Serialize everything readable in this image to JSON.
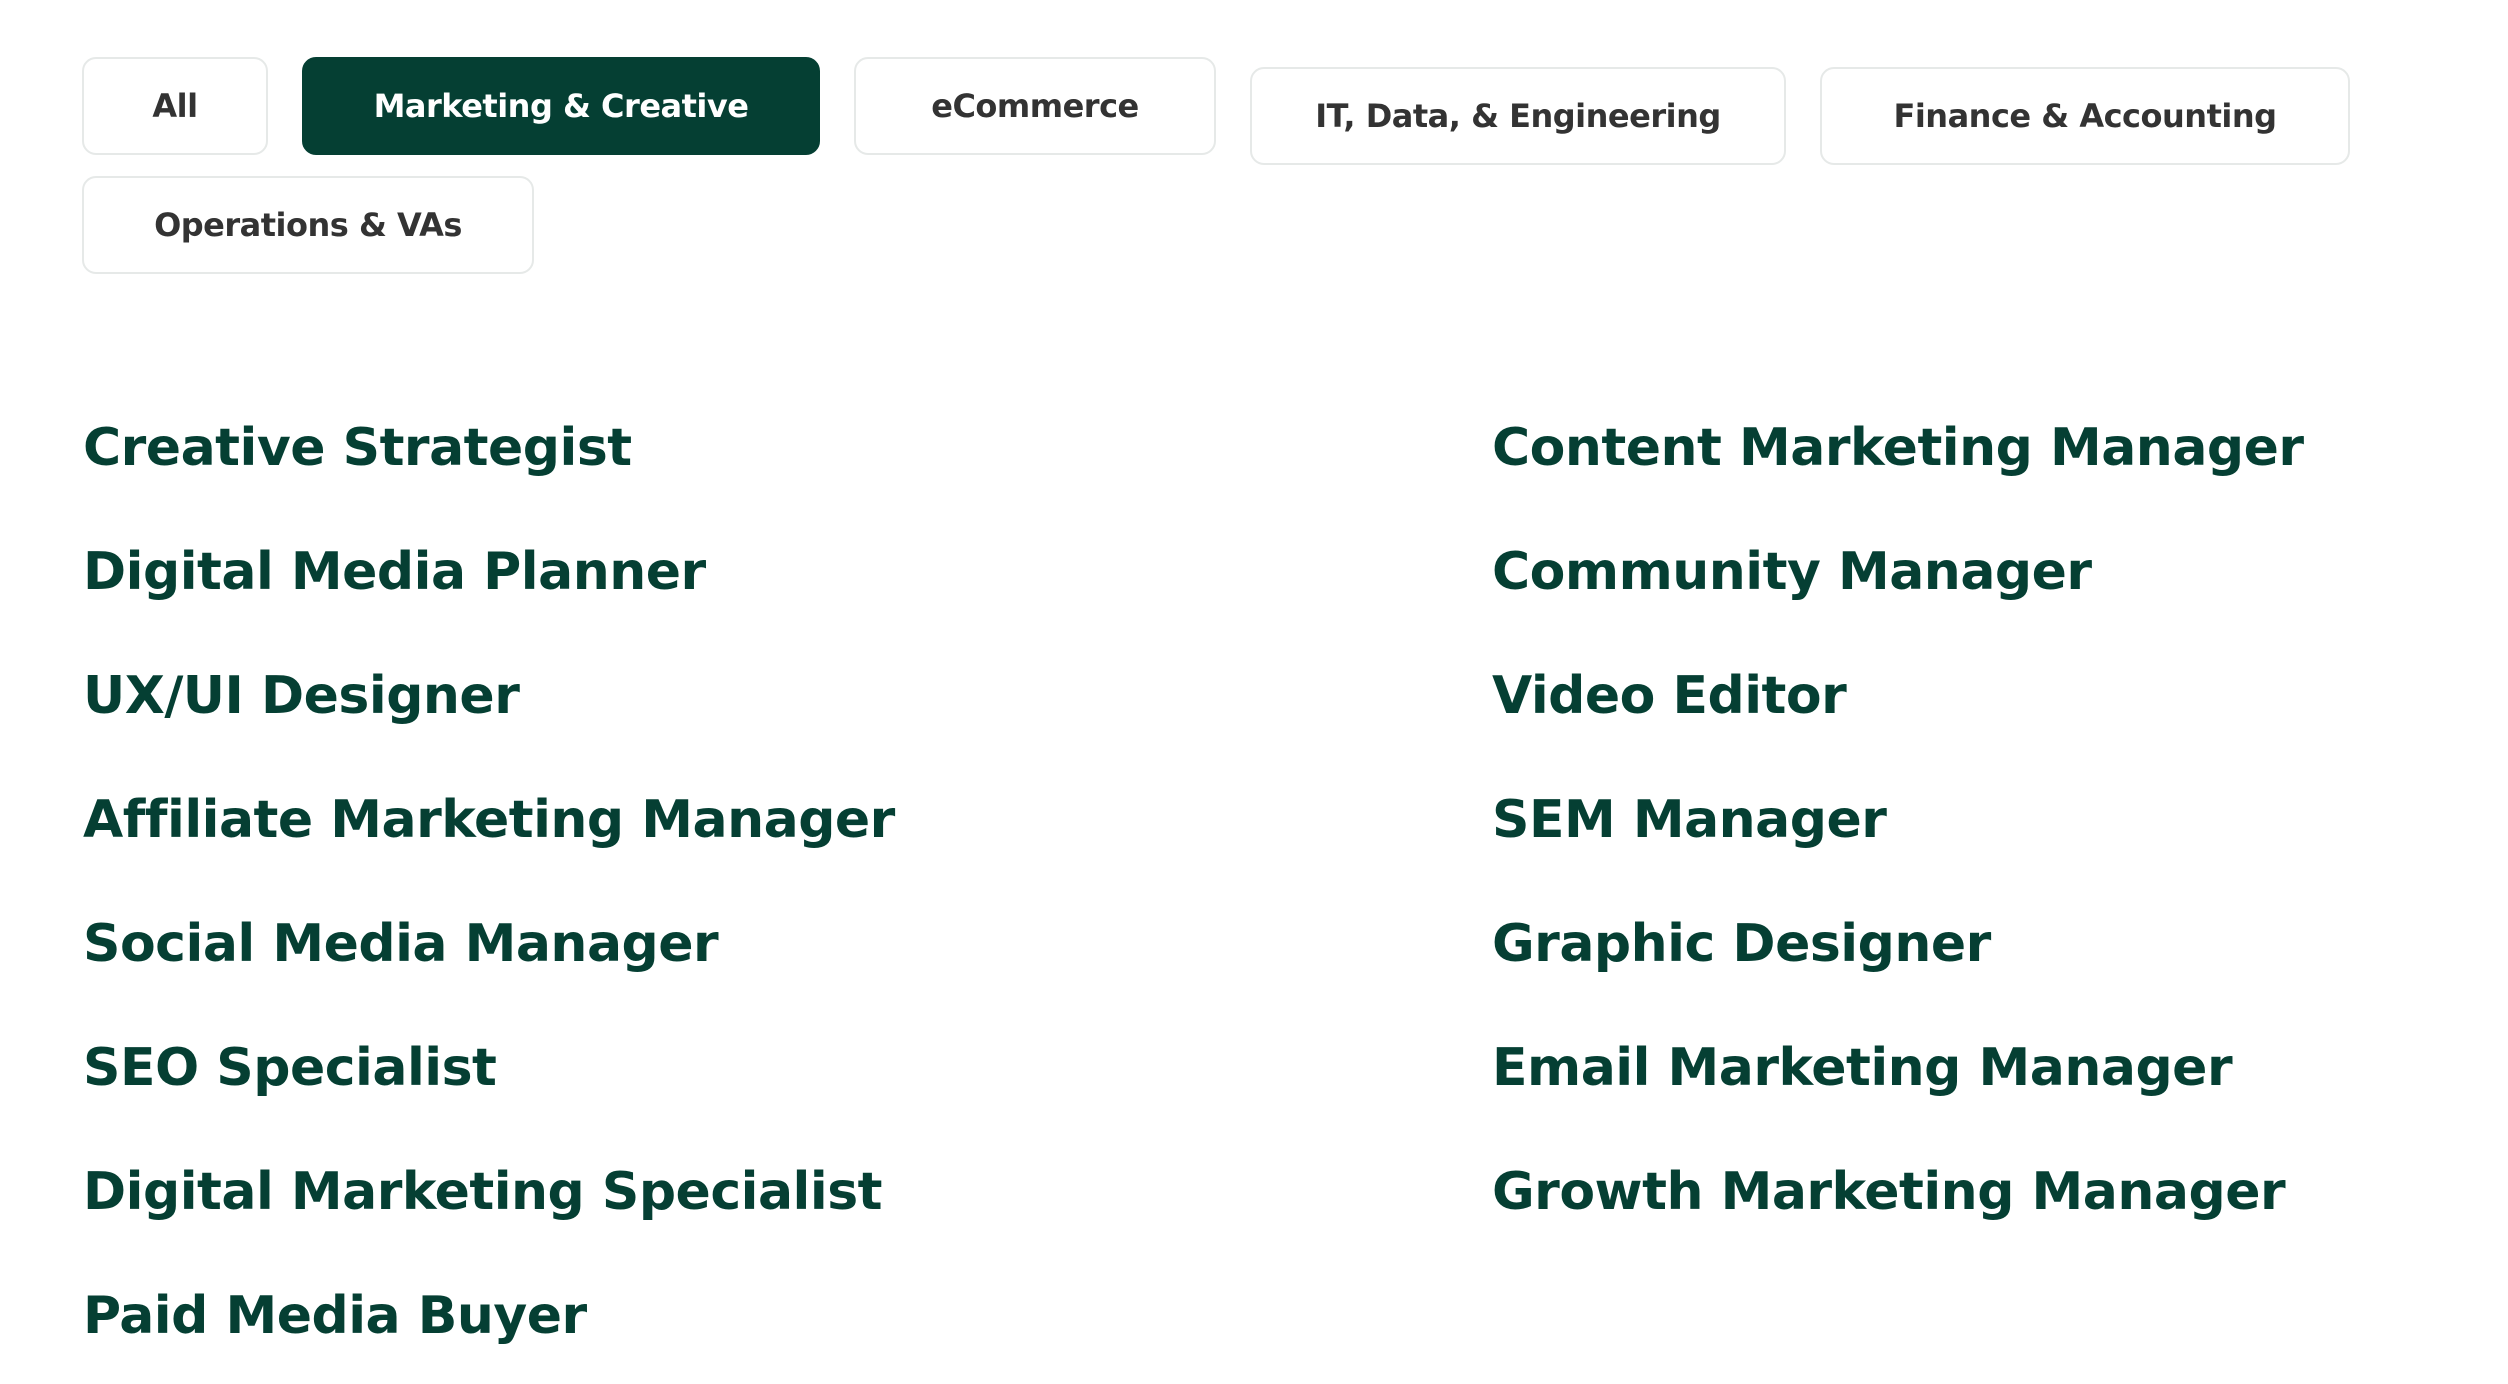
{
  "filters": {
    "selected": "Marketing & Creative",
    "items": [
      {
        "label": "All"
      },
      {
        "label": "Marketing & Creative"
      },
      {
        "label": "eCommerce"
      },
      {
        "label": "IT, Data, & Engineering"
      },
      {
        "label": "Finance & Accounting"
      },
      {
        "label": "Operations & VAs"
      }
    ]
  },
  "roles": {
    "left": [
      "Creative Strategist",
      "Digital Media Planner",
      "UX/UI Designer",
      "Affiliate Marketing Manager",
      "Social Media Manager",
      "SEO Specialist",
      "Digital Marketing Specialist",
      "Paid Media Buyer"
    ],
    "right": [
      "Content Marketing Manager",
      "Community Manager",
      "Video Editor",
      "SEM Manager",
      "Graphic Designer",
      "Email Marketing Manager",
      "Growth Marketing Manager"
    ]
  },
  "colors": {
    "accent": "#053f33",
    "button_text": "#333333",
    "button_border": "#e6e9e8"
  }
}
